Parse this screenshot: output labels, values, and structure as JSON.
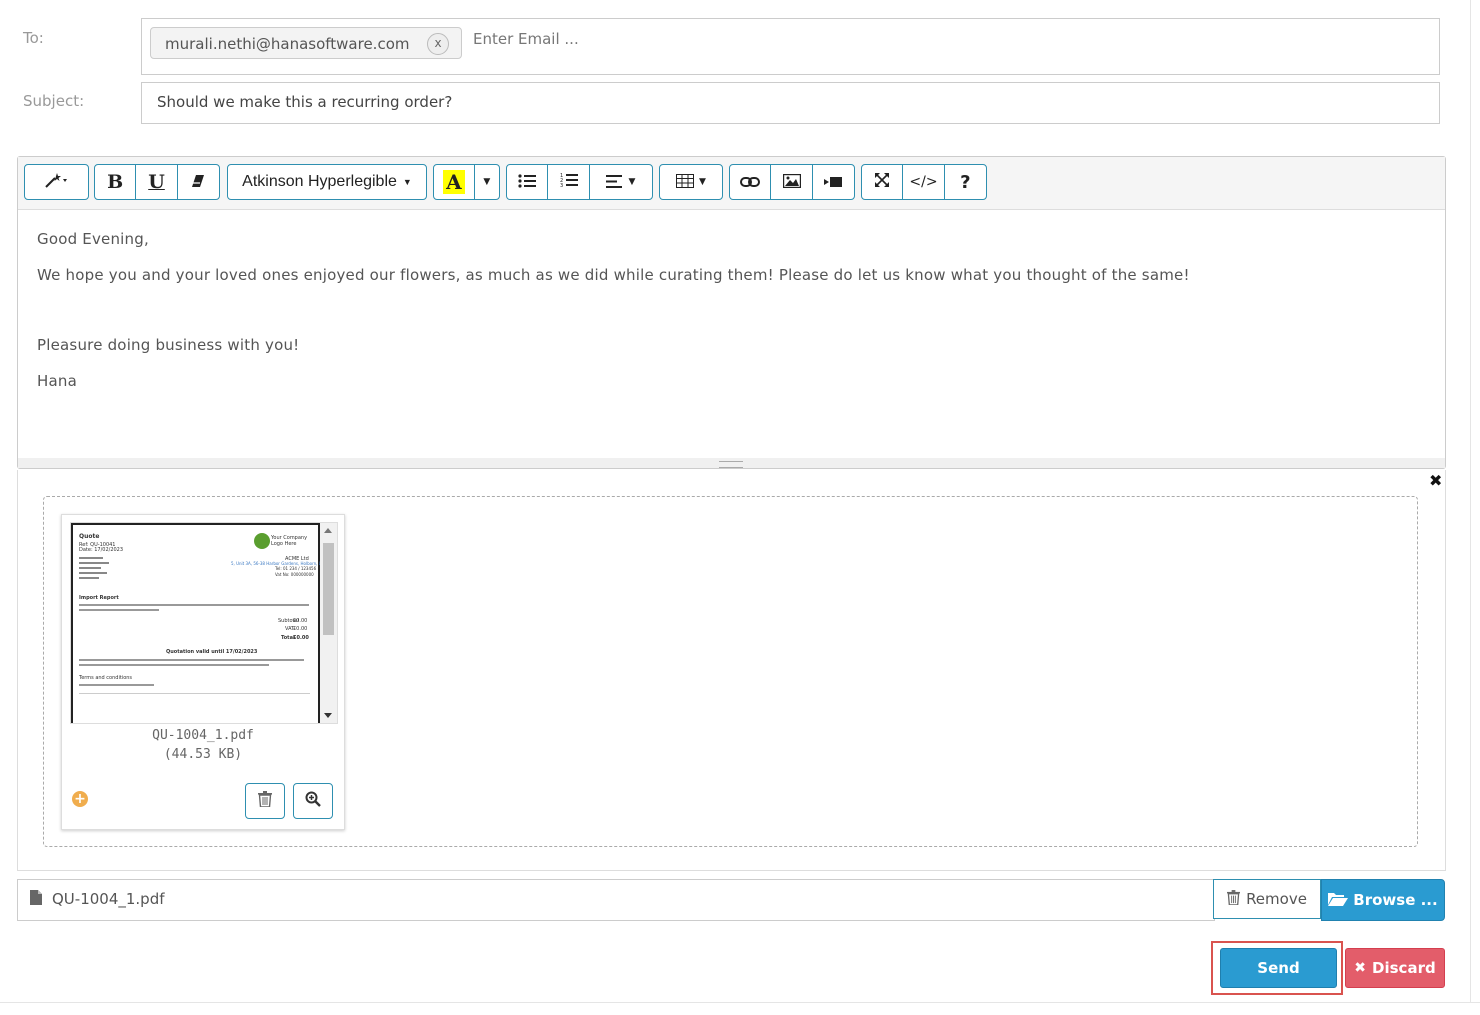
{
  "header": {
    "to_label": "To:",
    "recipients": [
      {
        "email": "murali.nethi@hanasoftware.com",
        "remove_label": "x"
      }
    ],
    "to_placeholder": "Enter Email ...",
    "subject_label": "Subject:",
    "subject_value": "Should we make this a recurring order?"
  },
  "toolbar": {
    "style_icon": "magic-wand-icon",
    "bold": "B",
    "underline": "U",
    "eraser_icon": "eraser-icon",
    "font_family": "Atkinson Hyperlegible",
    "font_color_label": "A",
    "highlight_color": "#ffff00",
    "unordered_list_icon": "unordered-list-icon",
    "ordered_list_icon": "ordered-list-icon",
    "align_icon": "align-left-icon",
    "table_icon": "table-icon",
    "link_icon": "link-icon",
    "picture_icon": "picture-icon",
    "video_icon": "video-icon",
    "fullscreen_icon": "fullscreen-icon",
    "code_label": "</>",
    "help_label": "?"
  },
  "body": {
    "greeting": "Good Evening,",
    "line1": "We hope you and your loved ones enjoyed our flowers, as much as we did while curating them! Please do let us know what you thought of the same!",
    "line2": "Pleasure doing business with you!",
    "signature": "Hana"
  },
  "attachment": {
    "close_label": "✖",
    "file_name": "QU-1004_1.pdf",
    "file_size": "(44.53 KB)",
    "preview": {
      "title": "Quote",
      "ref": "Ref: QU-10041",
      "date": "Date: 17/02/2023",
      "logo": "Your Company Logo Here",
      "company": "ACME Ltd",
      "address": "5, Unit 3A, 56-38 Harbor Gardens, Holborn, London",
      "tel": "Tel: 01 234 / 123456",
      "vat": "Vat No: 000000000",
      "section": "Import Report",
      "subtotal_label": "Subtotal",
      "vat_label": "VAT",
      "total_label": "Total",
      "amount": "£0.00",
      "valid": "Quotation valid until 17/02/2023",
      "terms": "Terms and conditions"
    }
  },
  "file_row": {
    "caption": "QU-1004_1.pdf",
    "remove_label": "Remove",
    "browse_label": "Browse ..."
  },
  "actions": {
    "send_label": "Send",
    "discard_label": "Discard"
  },
  "colors": {
    "primary": "#2a9bd1",
    "danger": "#e35d6a",
    "outline": "#2e8fb0",
    "highlight": "#d9534f"
  }
}
